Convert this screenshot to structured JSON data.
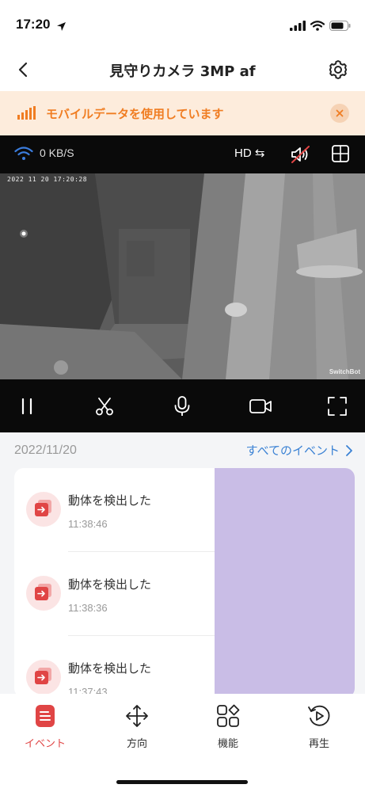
{
  "status_bar": {
    "time": "17:20"
  },
  "nav": {
    "title": "見守りカメラ 3MP af"
  },
  "banner": {
    "text": "モバイルデータを使用しています"
  },
  "video": {
    "speed": "0 KB/S",
    "quality_label": "HD ⇆",
    "timestamp": "2022 11 20 17:20:28",
    "watermark": "SwitchBot"
  },
  "events": {
    "date": "2022/11/20",
    "all_events_label": "すべてのイベント",
    "items": [
      {
        "title": "動体を検出した",
        "time": "11:38:46"
      },
      {
        "title": "動体を検出した",
        "time": "11:38:36"
      },
      {
        "title": "動体を検出した",
        "time": "11:37:43"
      }
    ]
  },
  "tabs": [
    {
      "label": "イベント",
      "icon": "event-list-icon",
      "active": true
    },
    {
      "label": "方向",
      "icon": "move-arrows-icon",
      "active": false
    },
    {
      "label": "機能",
      "icon": "features-grid-icon",
      "active": false
    },
    {
      "label": "再生",
      "icon": "playback-icon",
      "active": false
    }
  ],
  "colors": {
    "accent_orange": "#f07d22",
    "accent_red": "#e04545",
    "link_blue": "#3b82d4",
    "banner_bg": "#fdecdc",
    "thumbnail_placeholder": "#c9bde6"
  }
}
